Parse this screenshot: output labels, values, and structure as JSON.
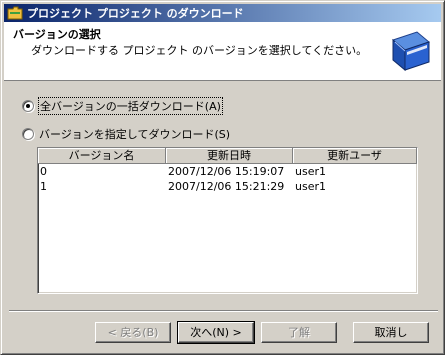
{
  "window": {
    "title": "プロジェクト プロジェクト のダウンロード"
  },
  "header": {
    "title": "バージョンの選択",
    "description": "ダウンロードする プロジェクト のバージョンを選択してください。"
  },
  "options": {
    "all_label": "全バージョンの一括ダウンロード(A)",
    "all_selected": true,
    "specific_label": "バージョンを指定してダウンロード(S)",
    "specific_selected": false
  },
  "versions_table": {
    "columns": [
      "バージョン名",
      "更新日時",
      "更新ユーザ"
    ],
    "rows": [
      {
        "name": "0",
        "date": "2007/12/06 15:19:07",
        "user": "user1"
      },
      {
        "name": "1",
        "date": "2007/12/06 15:21:29",
        "user": "user1"
      }
    ]
  },
  "buttons": {
    "back": "< 戻る(B)",
    "next": "次へ(N) >",
    "finish": "了解",
    "cancel": "取消し"
  },
  "icons": {
    "title": "folder-icon",
    "header": "book-icon"
  }
}
